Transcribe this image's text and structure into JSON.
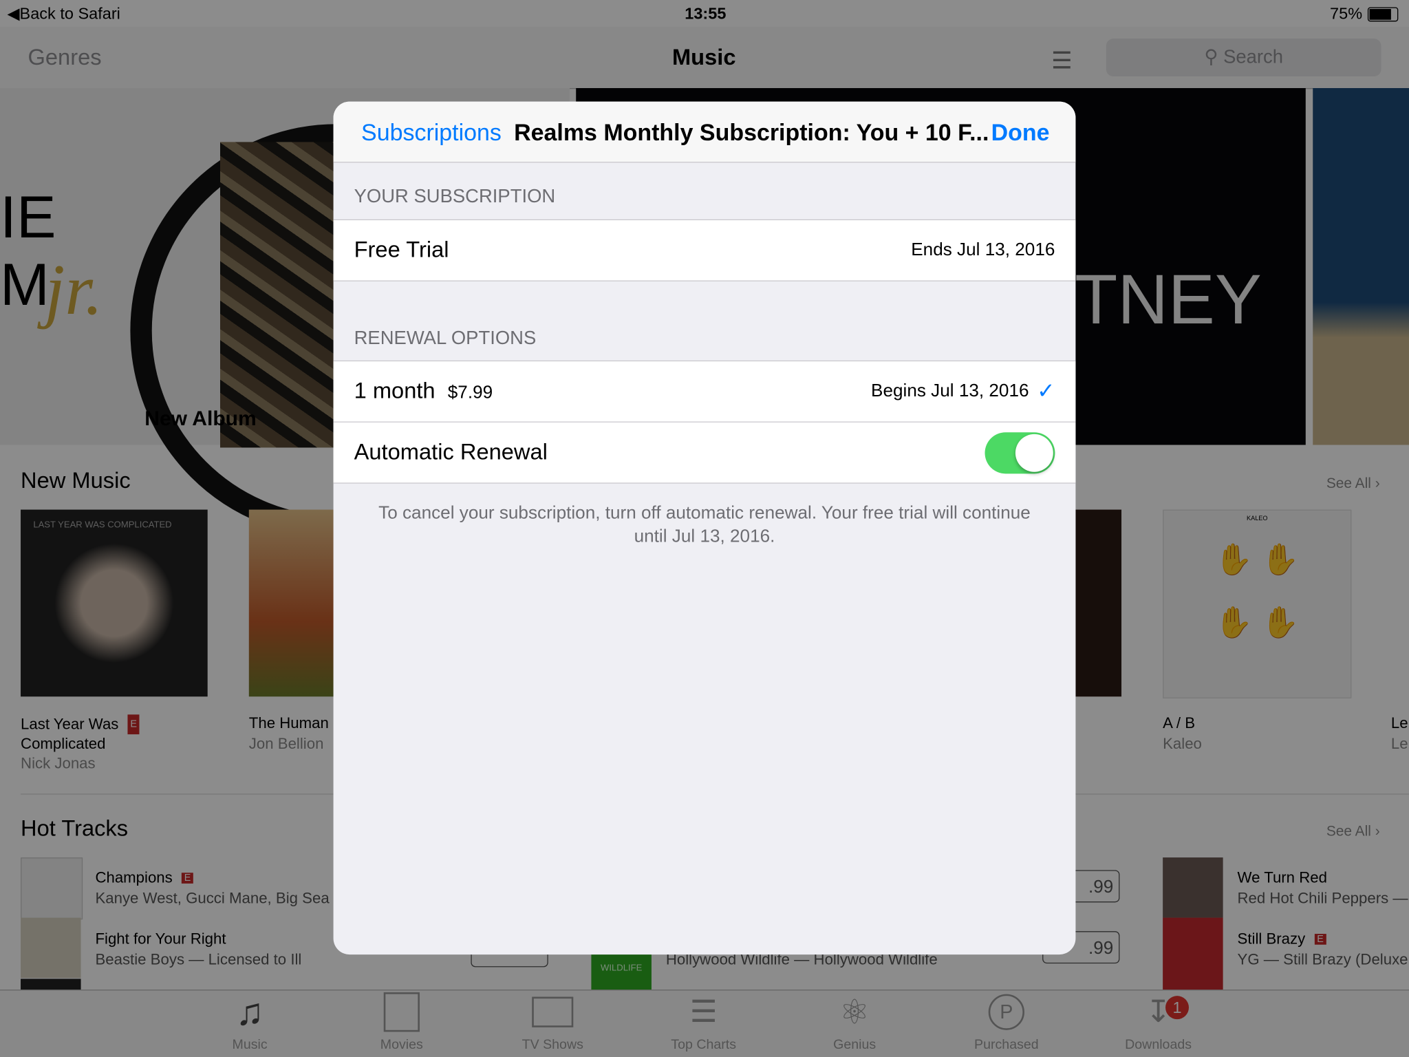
{
  "status_bar": {
    "back": "Back to Safari",
    "time": "13:55",
    "battery": "75%",
    "battery_level": 0.75
  },
  "nav": {
    "left": "Genres",
    "title": "Music",
    "search_placeholder": "Search"
  },
  "banner": {
    "label": "New Album",
    "left_art_text": "IE",
    "left_art_text2": "M",
    "left_art_script": "jr.",
    "middle_art_text": "TNEY"
  },
  "new_music": {
    "title": "New Music",
    "see_all": "See All",
    "albums": [
      {
        "title": "Last Year Was Complicated",
        "title_l1": "Last Year Was",
        "title_l2": "Complicated",
        "artist": "Nick Jonas",
        "explicit": "E",
        "art_text": "LAST YEAR WAS COMPLICATED"
      },
      {
        "title": "The Human",
        "artist": "Jon Bellion"
      },
      {
        "title": "A / B",
        "artist": "Kaleo",
        "art_text": "KALEO"
      },
      {
        "title": "Le",
        "artist": "Le"
      }
    ]
  },
  "hot_tracks": {
    "title": "Hot Tracks",
    "see_all": "See All",
    "tracks": [
      {
        "title": "Champions",
        "explicit": "E",
        "subtitle": "Kanye West, Gucci Mane, Big Sea"
      },
      {
        "title": "Fight for Your Right",
        "subtitle": "Beastie Boys — Licensed to Ill"
      },
      {
        "title": "",
        "subtitle": "Hollywood Wildlife — Hollywood Wildlife",
        "art_text": "WILDLIFE"
      },
      {
        "title": "We Turn Red",
        "subtitle": "Red Hot Chili Peppers —"
      },
      {
        "title": "Still Brazy",
        "explicit": "E",
        "subtitle": "YG — Still Brazy (Deluxe"
      }
    ],
    "prices": [
      ".99",
      ".99"
    ]
  },
  "tabs": [
    {
      "label": "Music",
      "icon": "music-note-icon"
    },
    {
      "label": "Movies",
      "icon": "film-icon"
    },
    {
      "label": "TV Shows",
      "icon": "tv-icon"
    },
    {
      "label": "Top Charts",
      "icon": "list-star-icon"
    },
    {
      "label": "Genius",
      "icon": "atom-icon"
    },
    {
      "label": "Purchased",
      "icon": "purchased-icon"
    },
    {
      "label": "Downloads",
      "icon": "download-icon",
      "badge": "1"
    }
  ],
  "modal": {
    "back": "Subscriptions",
    "title": "Realms Monthly Subscription: You + 10 F...",
    "done": "Done",
    "your_subscription_header": "YOUR SUBSCRIPTION",
    "current": {
      "label": "Free Trial",
      "detail": "Ends Jul 13, 2016"
    },
    "renewal_header": "RENEWAL OPTIONS",
    "option": {
      "label": "1 month",
      "price": "$7.99",
      "detail": "Begins Jul 13, 2016",
      "selected": true
    },
    "auto_renew": {
      "label": "Automatic Renewal",
      "on": true
    },
    "footer": "To cancel your subscription, turn off automatic renewal. Your free trial will continue until Jul 13, 2016."
  },
  "colors": {
    "accent": "#007aff",
    "toggle_on": "#4cd964",
    "badge": "#e0342f"
  }
}
